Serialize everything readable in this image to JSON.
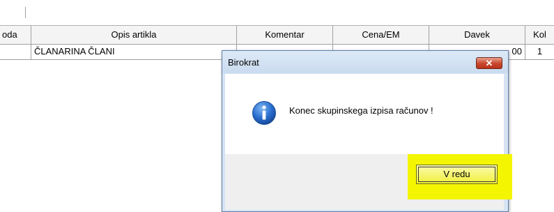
{
  "grid": {
    "columns": [
      "oda",
      "Opis artikla",
      "Komentar",
      "Cena/EM",
      "Davek",
      "Kol"
    ],
    "row": {
      "opis": "ČLANARINA ČLANI",
      "davek_tail": "00",
      "kol": "1"
    }
  },
  "dialog": {
    "title": "Birokrat",
    "close_glyph": "✕",
    "message": "Konec skupinskega izpisa računov !",
    "icon": "info-icon",
    "ok_label": "V redu"
  },
  "colors": {
    "highlight": "#f4f500",
    "dialog_frame": "#d5e3f3",
    "close_red": "#c9452c"
  }
}
